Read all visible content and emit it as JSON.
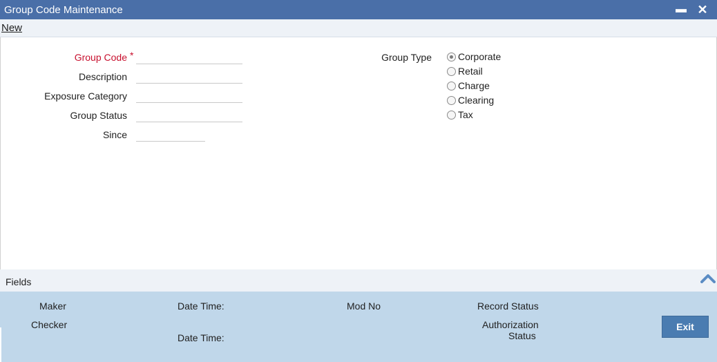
{
  "window": {
    "title": "Group Code Maintenance",
    "minimize_glyph": "▬",
    "close_glyph": "✕"
  },
  "menu": {
    "new_label": "New"
  },
  "form": {
    "group_code_label": "Group Code",
    "required_mark": "*",
    "description_label": "Description",
    "exposure_category_label": "Exposure Category",
    "group_status_label": "Group Status",
    "since_label": "Since",
    "group_code_value": "",
    "description_value": "",
    "exposure_category_value": "",
    "group_status_value": "",
    "since_value": "",
    "group_type_label": "Group Type",
    "group_type_options": [
      "Corporate",
      "Retail",
      "Charge",
      "Clearing",
      "Tax"
    ],
    "group_type_selected": "Corporate"
  },
  "fields_bar": {
    "label": "Fields",
    "chevron_icon": "chevron-up-icon"
  },
  "footer": {
    "maker_label": "Maker",
    "checker_label": "Checker",
    "date_time_label": "Date Time:",
    "mod_no_label": "Mod No",
    "record_status_label": "Record Status",
    "authorization_label_1": "Authorization",
    "authorization_label_2": "Status",
    "exit_label": "Exit"
  },
  "colors": {
    "title_bar": "#4a6fa8",
    "required_label": "#c8102e",
    "footer_bg": "#c0d7ea",
    "exit_button": "#4a7cb1"
  }
}
